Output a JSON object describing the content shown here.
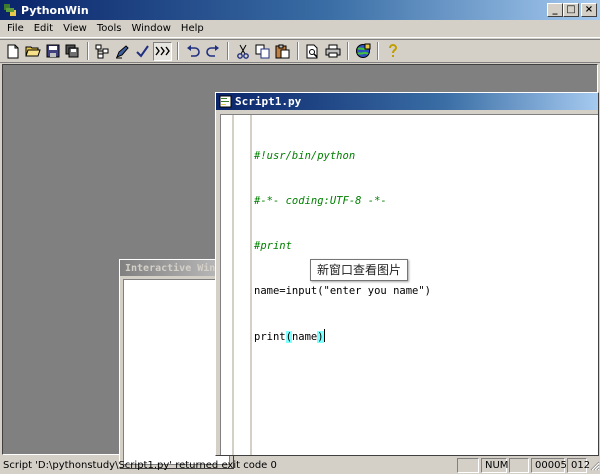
{
  "app": {
    "title": "PythonWin",
    "window_buttons": {
      "minimize": "_",
      "maximize": "□",
      "close": "×"
    }
  },
  "menu": [
    "File",
    "Edit",
    "View",
    "Tools",
    "Window",
    "Help"
  ],
  "toolbar": {
    "buttons": [
      "new-file-icon",
      "open-folder-icon",
      "save-icon",
      "save-all-icon",
      "browser-icon",
      "pencil-icon",
      "check-icon",
      "indent-icon",
      "undo-icon",
      "redo-icon",
      "cut-icon",
      "copy-icon",
      "paste-icon",
      "print-preview-icon",
      "print-icon",
      "object-browser-icon",
      "help-icon"
    ]
  },
  "interactive_window": {
    "title": "Interactive Window"
  },
  "script_window": {
    "title": "Script1.py",
    "lines": [
      {
        "text": "#!usr/bin/python",
        "kind": "comment"
      },
      {
        "text": "#-*- coding:UTF-8 -*-",
        "kind": "comment"
      },
      {
        "text": "#print",
        "kind": "comment"
      },
      {
        "text": "name=input(\"enter you name\")",
        "kind": "code"
      },
      {
        "text_pre": "print",
        "text_paren_open": "(",
        "text_mid": "name",
        "text_paren_close": ")",
        "kind": "code"
      }
    ]
  },
  "tooltip": {
    "text": "新窗口查看图片"
  },
  "statusbar": {
    "message": "Script 'D:\\pythonstudy\\Script1.py' returned exit code 0",
    "panes": [
      "",
      "NUM",
      "",
      "00005",
      "012"
    ]
  },
  "colors": {
    "title_active": "#0a246a",
    "comment": "#008000",
    "paren_highlight": "#80ffff"
  }
}
